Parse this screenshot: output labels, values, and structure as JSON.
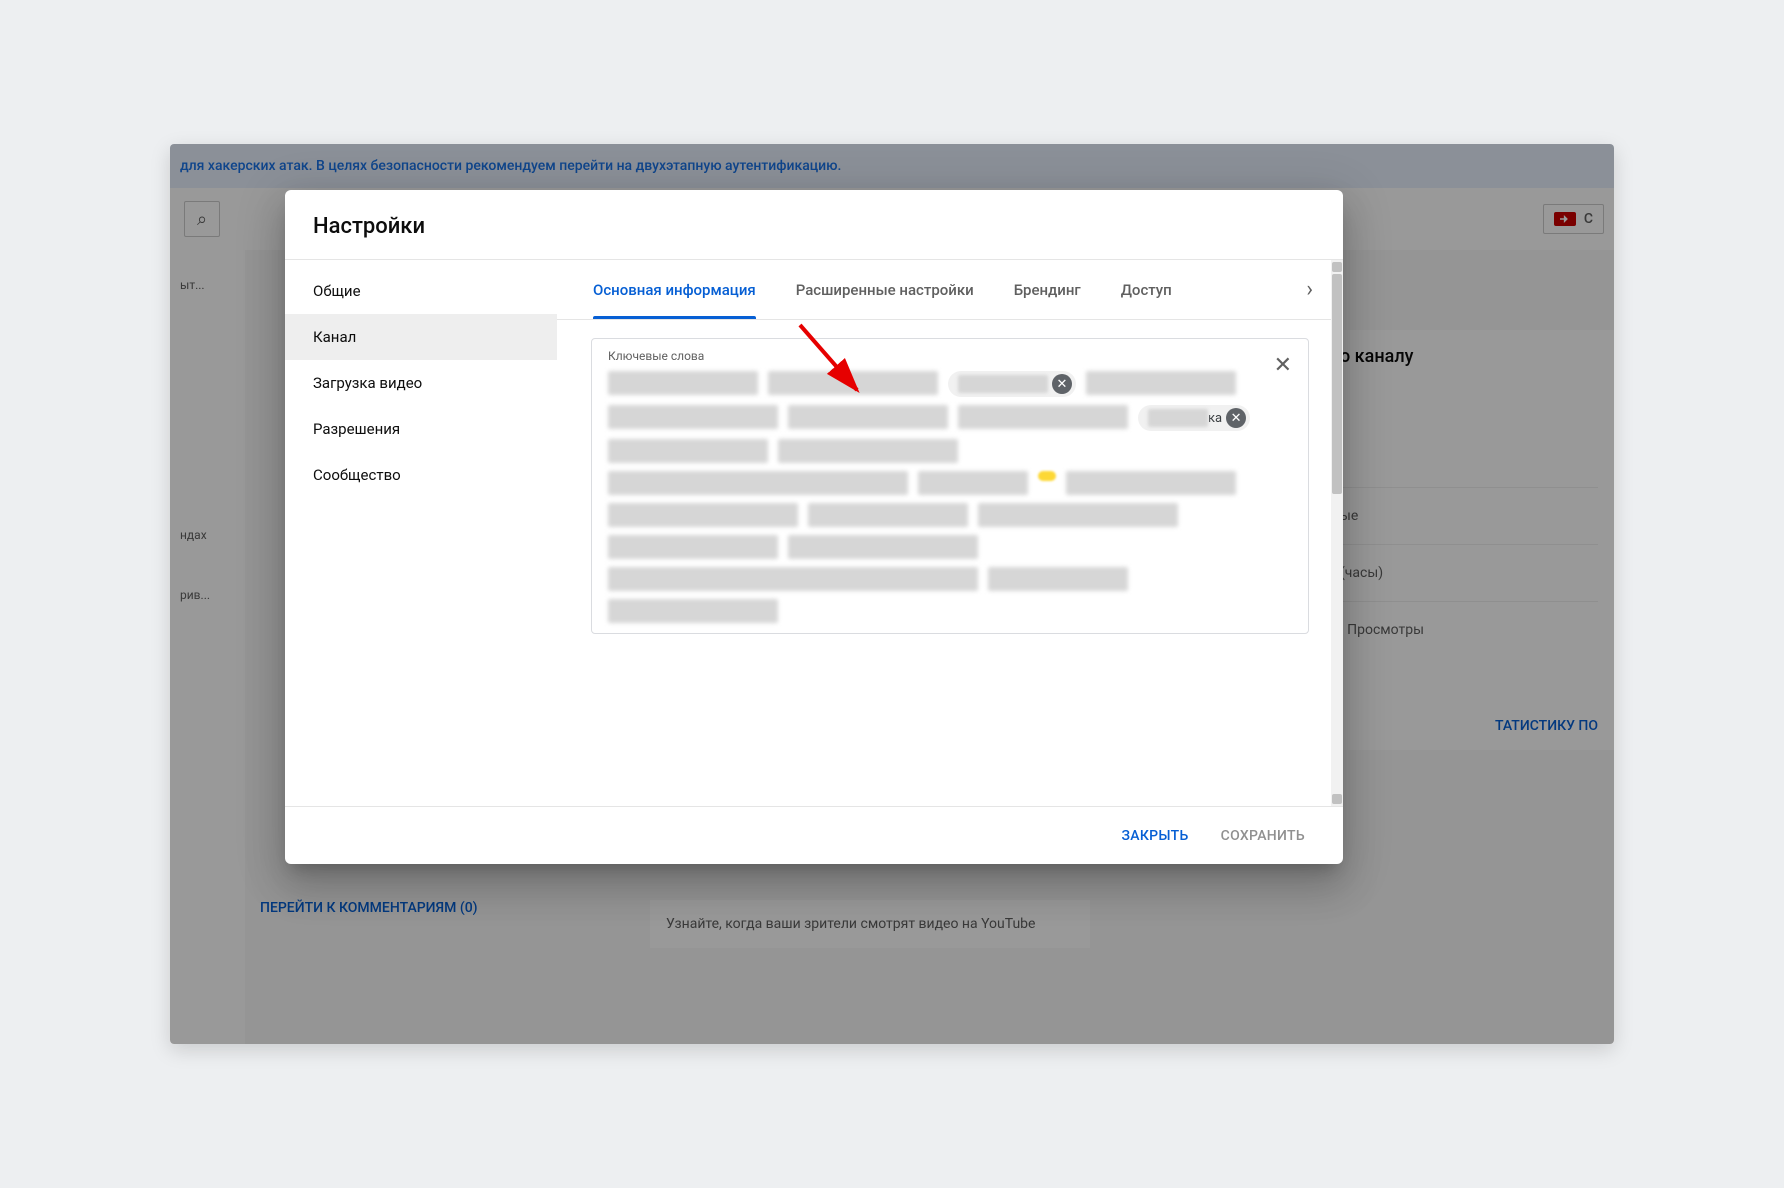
{
  "background": {
    "banner_text": "для хакерских атак. В целях безопасности рекомендуем перейти на двухэтапную аутентификацию.",
    "create_label": "С",
    "left_items": [
      "ыт...",
      "ндах",
      "рив..."
    ],
    "right_panel_title": "о каналу",
    "right_row1": "ые",
    "right_row2": "(часы)",
    "right_row3": "· Просмотры",
    "right_link": "ТАТИСТИКУ ПО",
    "bottom_left": "ПЕРЕЙТИ К КОММЕНТАРИЯМ (0)",
    "bottom_mid": "Узнайте, когда ваши зрители смотрят видео на YouTube"
  },
  "dialog": {
    "title": "Настройки",
    "sidebar": [
      {
        "label": "Общие",
        "active": false
      },
      {
        "label": "Канал",
        "active": true
      },
      {
        "label": "Загрузка видео",
        "active": false
      },
      {
        "label": "Разрешения",
        "active": false
      },
      {
        "label": "Сообщество",
        "active": false
      }
    ],
    "tabs": [
      {
        "label": "Основная информация",
        "active": true
      },
      {
        "label": "Расширенные настройки",
        "active": false
      },
      {
        "label": "Брендинг",
        "active": false
      },
      {
        "label": "Доступ",
        "active": false
      }
    ],
    "keywords_label": "Ключевые слова",
    "chip_visible_text": "ка",
    "footer_close": "ЗАКРЫТЬ",
    "footer_save": "СОХРАНИТЬ"
  }
}
